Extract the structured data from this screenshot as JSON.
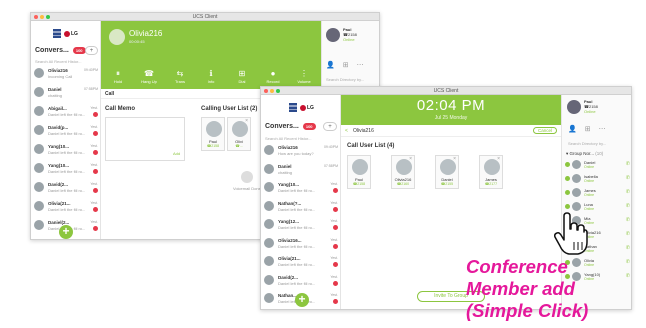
{
  "window1": {
    "title": "UCS Client",
    "caller_name": "Olivia216",
    "caller_status": "00:00:45",
    "convo_header": "Convers...",
    "convo_badge": "100",
    "new_label": "+",
    "search_placeholder": "Search All Recent Histor...",
    "actions": [
      {
        "icon": "⏸",
        "label": "Hold"
      },
      {
        "icon": "☎",
        "label": "Hang Up"
      },
      {
        "icon": "⇆",
        "label": "Trans"
      },
      {
        "icon": "ℹ",
        "label": "Info"
      },
      {
        "icon": "⊞",
        "label": "Dial"
      },
      {
        "icon": "●",
        "label": "Record"
      },
      {
        "icon": "⋮",
        "label": "Volume"
      }
    ],
    "call_label": "Call",
    "memo_label": "Call Memo",
    "memo_button": "Add",
    "calling_list_label": "Calling User List (2)",
    "cards": [
      {
        "name": "Paul",
        "status": "☎2158"
      },
      {
        "name": "Olivi",
        "status": "☎..."
      }
    ],
    "voicemail_label": "Voicemail Done",
    "me_name": "Paul",
    "me_ext": "☎2158",
    "me_status": "Online",
    "right_search": "Search Directory by...",
    "conversations": [
      {
        "name": "Olivia216",
        "msg": "Incoming Call",
        "time": "09:40PM",
        "unread": false
      },
      {
        "name": "Daniel",
        "msg": "chatting",
        "time": "07:58PM",
        "unread": false
      },
      {
        "name": "Abigail...",
        "msg": "Daniel left the fill ro...",
        "time": "Yest.",
        "unread": true
      },
      {
        "name": "David(p...",
        "msg": "Daniel left the fill ro...",
        "time": "Yest.",
        "unread": true
      },
      {
        "name": "Yang(10...",
        "msg": "Daniel left the fill ro...",
        "time": "Yest.",
        "unread": true
      },
      {
        "name": "Yang(10...",
        "msg": "Daniel left the fill ro...",
        "time": "Yest.",
        "unread": true
      },
      {
        "name": "David(2...",
        "msg": "Daniel left the fill ro...",
        "time": "Yest.",
        "unread": true
      },
      {
        "name": "Olivia(21...",
        "msg": "Daniel left the fill ro...",
        "time": "Yest.",
        "unread": true
      },
      {
        "name": "Daniel(2...",
        "msg": "Daniel left the fill ro...",
        "time": "Yest.",
        "unread": true
      }
    ]
  },
  "window2": {
    "title": "UCS Client",
    "clock": "02:04 PM",
    "date": "Jul 25 Monday",
    "convo_header": "Convers...",
    "convo_badge": "100",
    "new_label": "+",
    "search_placeholder": "Search All Recent Histor...",
    "breadcrumb_back": "<",
    "breadcrumb_name": "Olivia216",
    "cancel_button": "Cancel",
    "call_label": "Call User List (4)",
    "invite_button": "Invite To Group",
    "cards": [
      {
        "name": "Paul",
        "status": "☎2158"
      },
      {
        "name": "Olivia216",
        "status": "☎2160"
      },
      {
        "name": "Daniel",
        "status": "☎2155"
      },
      {
        "name": "James",
        "status": "☎2177"
      }
    ],
    "me_name": "Paul",
    "me_ext": "☎2158",
    "me_status": "Online",
    "right_search": "Search Directory by...",
    "group_label": "Group Nor...",
    "group_count": "(10)",
    "conversations": [
      {
        "name": "Olivia216",
        "msg": "How are you today?",
        "time": "09:40PM",
        "unread": false
      },
      {
        "name": "Daniel",
        "msg": "chatting",
        "time": "07:58PM",
        "unread": false
      },
      {
        "name": "Yang(10...",
        "msg": "Daniel left the fill ro...",
        "time": "Yest.",
        "unread": true
      },
      {
        "name": "Nathan(?...",
        "msg": "Daniel left the fill ro...",
        "time": "Yest.",
        "unread": true
      },
      {
        "name": "Yang(12...",
        "msg": "Daniel left the fill ro...",
        "time": "Yest.",
        "unread": true
      },
      {
        "name": "Olivia216...",
        "msg": "Daniel left the fill ro...",
        "time": "Yest.",
        "unread": true
      },
      {
        "name": "Olivia(21...",
        "msg": "Daniel left the fill ro...",
        "time": "Yest.",
        "unread": true
      },
      {
        "name": "David(2...",
        "msg": "Daniel left the fill ro...",
        "time": "Yest.",
        "unread": true
      },
      {
        "name": "Nathan...",
        "msg": "Daniel left the fill ro...",
        "time": "Yest.",
        "unread": true
      }
    ],
    "group_members": [
      {
        "name": "Daniel",
        "status": "Online"
      },
      {
        "name": "Isabella",
        "status": "Online"
      },
      {
        "name": "James",
        "status": "Online"
      },
      {
        "name": "Luna",
        "status": "Online"
      },
      {
        "name": "Mia",
        "status": "Online"
      },
      {
        "name": "Olivia216",
        "status": "Online"
      },
      {
        "name": "Nathan",
        "status": "Online"
      },
      {
        "name": "Olivia",
        "status": "Online"
      },
      {
        "name": "Yang(10)",
        "status": "Online"
      }
    ]
  },
  "overlay": {
    "line1": "Conference",
    "line2": "Member add",
    "line3": "(Simple Click)"
  },
  "colors": {
    "accent_green": "#8cc63f",
    "badge_red": "#e5384a",
    "overlay_magenta": "#e5189b"
  }
}
